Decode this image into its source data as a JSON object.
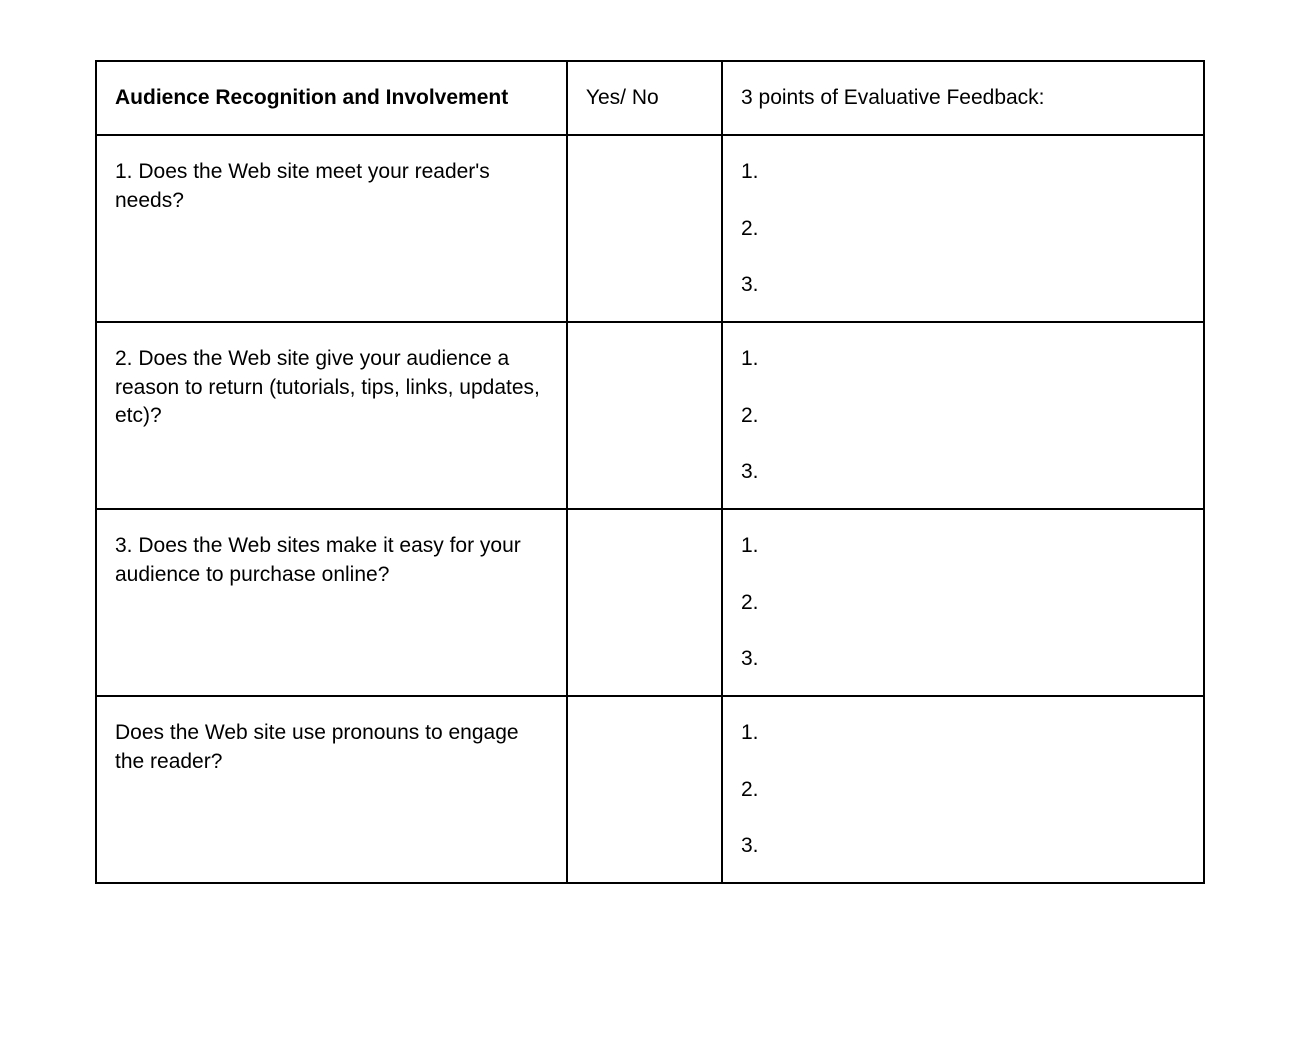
{
  "table": {
    "headers": {
      "col1": "Audience Recognition and Involvement",
      "col2": "Yes/ No",
      "col3": "3 points of Evaluative Feedback:"
    },
    "rows": [
      {
        "question": "1. Does the Web site meet your reader's needs?",
        "yesno": "",
        "feedback": [
          "1.",
          "2.",
          "3."
        ]
      },
      {
        "question": "2. Does the Web site give your audience a reason to return (tutorials, tips, links, updates, etc)?",
        "yesno": "",
        "feedback": [
          "1.",
          "2.",
          "3."
        ]
      },
      {
        "question": "3. Does the Web sites make it easy for your audience to purchase online?",
        "yesno": "",
        "feedback": [
          "1.",
          "2.",
          "3."
        ]
      },
      {
        "question": "Does the Web site use pronouns to engage the reader?",
        "yesno": "",
        "feedback": [
          "1.",
          "2.",
          "3."
        ]
      }
    ]
  }
}
